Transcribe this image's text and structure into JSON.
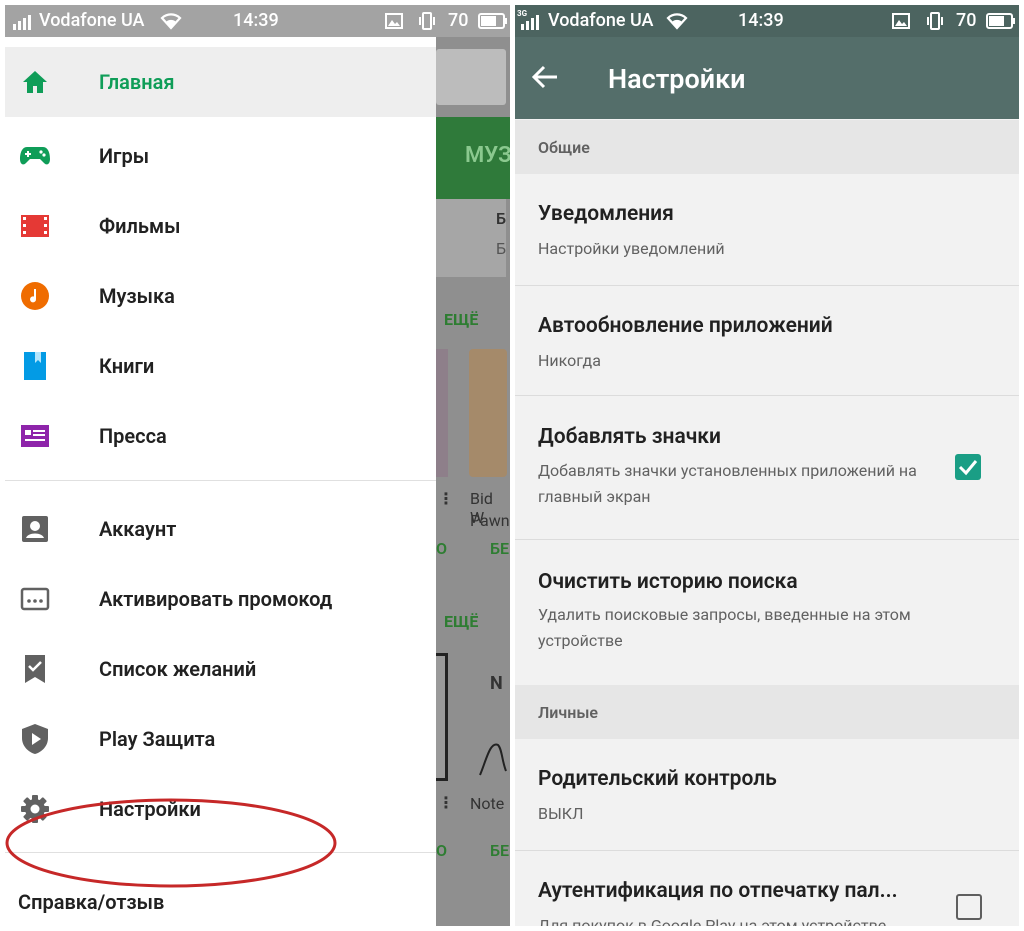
{
  "status_bar": {
    "carrier": "Vodafone UA",
    "network_type": "3G",
    "time": "14:39",
    "battery": "70"
  },
  "drawer": {
    "items": [
      {
        "label": "Главная",
        "icon": "home-icon"
      },
      {
        "label": "Игры",
        "icon": "gamepad-icon"
      },
      {
        "label": "Фильмы",
        "icon": "film-icon"
      },
      {
        "label": "Музыка",
        "icon": "music-icon"
      },
      {
        "label": "Книги",
        "icon": "book-icon"
      },
      {
        "label": "Пресса",
        "icon": "newsstand-icon"
      },
      {
        "label": "Аккаунт",
        "icon": "account-icon"
      },
      {
        "label": "Активировать промокод",
        "icon": "promo-code-icon"
      },
      {
        "label": "Список желаний",
        "icon": "wishlist-icon"
      },
      {
        "label": "Play Защита",
        "icon": "shield-play-icon"
      },
      {
        "label": "Настройки",
        "icon": "gear-icon"
      }
    ],
    "help_label": "Справка/отзыв"
  },
  "background_app": {
    "tab_label": "МУЗ",
    "more_label": "ЕЩЁ",
    "more_label_2": "ЕЩЁ",
    "app_card_title_1": "Bid W",
    "app_card_title_2": "Pawn",
    "app_card_free": "БЕ",
    "app_card_free_2": "БЕ",
    "card_letter_1": "Б",
    "card_letter_2": "Б",
    "card_letter_3": "О",
    "card_letter_4": "О",
    "note_title": "Note",
    "note_letter": "N"
  },
  "settings": {
    "title": "Настройки",
    "sections": [
      {
        "header": "Общие",
        "items": [
          {
            "title": "Уведомления",
            "summary": "Настройки уведомлений"
          },
          {
            "title": "Автообновление приложений",
            "summary": "Никогда"
          },
          {
            "title": "Добавлять значки",
            "summary": "Добавлять значки установленных приложений на главный экран",
            "checked": true
          },
          {
            "title": "Очистить историю поиска",
            "summary": "Удалить поисковые запросы, введенные на этом устройстве"
          }
        ]
      },
      {
        "header": "Личные",
        "items": [
          {
            "title": "Родительский контроль",
            "summary": "ВЫКЛ"
          },
          {
            "title": "Аутентификация по отпечатку пал...",
            "summary": "Для покупок в Google Play на этом устройстве",
            "checked": false
          }
        ]
      }
    ]
  },
  "colors": {
    "play_green": "#0f9d58",
    "toolbar": "#546e6a",
    "checkbox_on": "#1a9e85",
    "highlight_circle": "#c62828"
  }
}
